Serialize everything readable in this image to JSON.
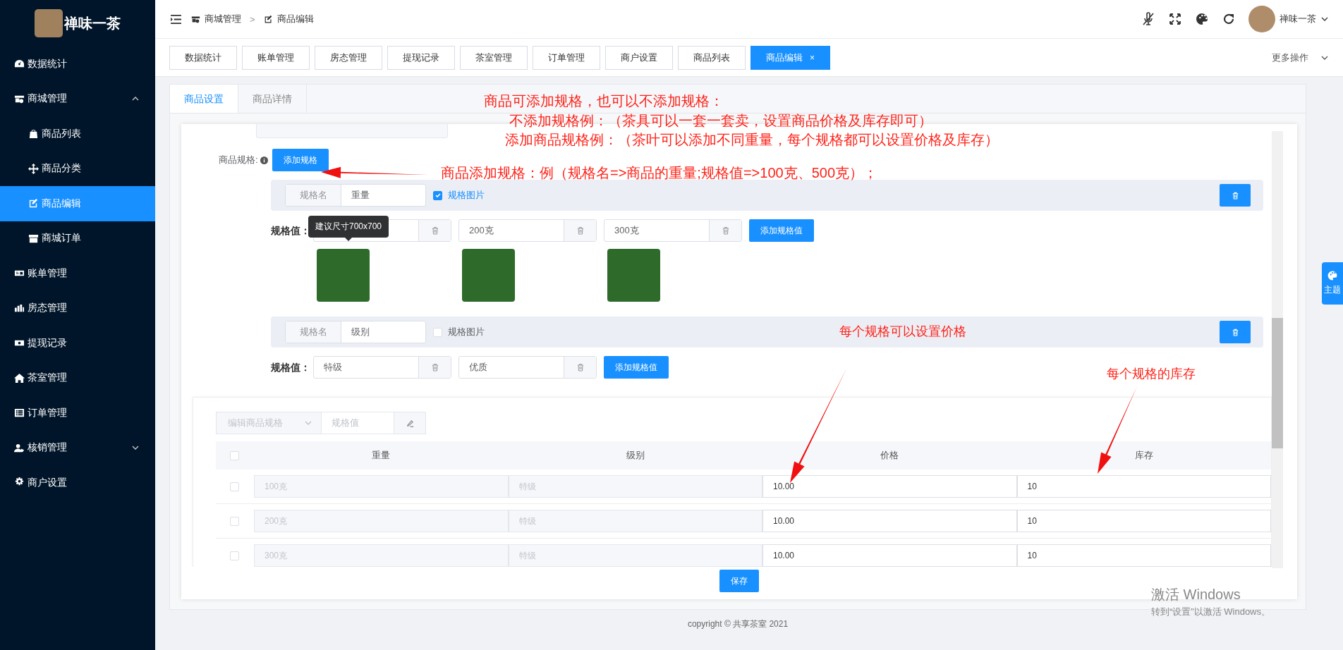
{
  "sidebar": {
    "brand": "禅味一茶",
    "items": [
      {
        "label": "数据统计",
        "selected": false
      },
      {
        "label": "商城管理",
        "selected": false,
        "expanded": true,
        "children": [
          {
            "label": "商品列表",
            "selected": false
          },
          {
            "label": "商品分类",
            "selected": false
          },
          {
            "label": "商品编辑",
            "selected": true
          },
          {
            "label": "商城订单",
            "selected": false
          }
        ]
      },
      {
        "label": "账单管理",
        "selected": false
      },
      {
        "label": "房态管理",
        "selected": false
      },
      {
        "label": "提现记录",
        "selected": false
      },
      {
        "label": "茶室管理",
        "selected": false
      },
      {
        "label": "订单管理",
        "selected": false
      },
      {
        "label": "核销管理",
        "selected": false,
        "expanded": false
      },
      {
        "label": "商户设置",
        "selected": false
      }
    ]
  },
  "header": {
    "breadcrumb": [
      "商城管理",
      "商品编辑"
    ],
    "separator": ">",
    "user": "禅味一茶"
  },
  "page_tabs": [
    {
      "label": "数据统计",
      "selected": false
    },
    {
      "label": "账单管理",
      "selected": false
    },
    {
      "label": "房态管理",
      "selected": false
    },
    {
      "label": "提现记录",
      "selected": false
    },
    {
      "label": "茶室管理",
      "selected": false
    },
    {
      "label": "订单管理",
      "selected": false
    },
    {
      "label": "商户设置",
      "selected": false
    },
    {
      "label": "商品列表",
      "selected": false
    },
    {
      "label": "商品编辑",
      "selected": true,
      "close": "×"
    }
  ],
  "more_actions": "更多操作",
  "form_tabs": [
    {
      "label": "商品设置",
      "selected": true
    },
    {
      "label": "商品详情",
      "selected": false
    }
  ],
  "spec_field": {
    "label": "商品规格:",
    "add_button": "添加规格"
  },
  "spec_groups": [
    {
      "name_label": "规格名",
      "name": "重量",
      "image_checked": true,
      "image_label": "规格图片",
      "values_label": "规格值：",
      "values": [
        {
          "tooltip": "建议尺寸700x700"
        },
        {
          "text": "200克"
        },
        {
          "text": "300克"
        }
      ],
      "add_value_button": "添加规格值"
    },
    {
      "name_label": "规格名",
      "name": "级别",
      "image_checked": false,
      "image_label": "规格图片",
      "values_label": "规格值：",
      "values": [
        {
          "text": "特级"
        },
        {
          "text": "优质"
        }
      ],
      "add_value_button": "添加规格值"
    }
  ],
  "batch": {
    "select_placeholder": "编辑商品规格",
    "value_placeholder": "规格值"
  },
  "table": {
    "header_checked": false,
    "columns": [
      "重量",
      "级别",
      "价格",
      "库存"
    ],
    "rows": [
      {
        "checked": false,
        "cells": [
          "100克",
          "特级",
          "10.00",
          "10"
        ]
      },
      {
        "checked": false,
        "cells": [
          "200克",
          "特级",
          "10.00",
          "10"
        ]
      },
      {
        "checked": false,
        "cells": [
          "300克",
          "特级",
          "10.00",
          "10"
        ]
      }
    ]
  },
  "save_button": "保存",
  "theme_button": "主题",
  "footer": "copyright © 共享茶室 2021",
  "annotations": [
    {
      "text": "商品可添加规格，也可以不添加规格："
    },
    {
      "text": "不添加规格例：（茶具可以一套一套卖，设置商品价格及库存即可）"
    },
    {
      "text": "添加商品规格例：（茶叶可以添加不同重量，每个规格都可以设置价格及库存）"
    },
    {
      "text": "商品添加规格：例（规格名=>商品的重量;规格值=>100克、500克）；"
    },
    {
      "text": "每个规格可以设置价格"
    },
    {
      "text": "每个规格的库存"
    }
  ],
  "os_notice": {
    "title": "激活 Windows",
    "subtitle": "转到“设置”以激活 Windows。"
  }
}
